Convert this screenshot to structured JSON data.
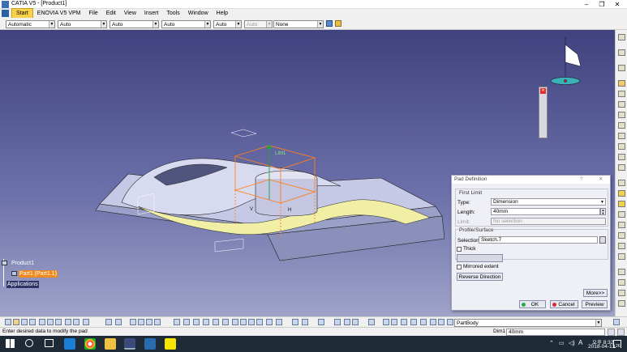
{
  "window": {
    "title": "CATIA V5 - [Product1]",
    "min": "–",
    "max": "❐",
    "close": "✕"
  },
  "menu": [
    "Start",
    "ENOVIA V5 VPM",
    "File",
    "Edit",
    "View",
    "Insert",
    "Tools",
    "Window",
    "Help"
  ],
  "combos": [
    {
      "value": "Automatic",
      "disabled": false
    },
    {
      "value": "Auto",
      "disabled": false
    },
    {
      "value": "Auto",
      "disabled": false
    },
    {
      "value": "Auto",
      "disabled": false
    },
    {
      "value": "Auto",
      "disabled": false
    },
    {
      "value": "Auto",
      "disabled": true
    },
    {
      "value": "None",
      "disabled": false
    }
  ],
  "tree": {
    "root": "Product1",
    "part": "Part1 (Part1.1)",
    "apps": "Applications"
  },
  "annotations": {
    "lim1": "LIM1",
    "h": "H",
    "v": "V"
  },
  "dialog": {
    "title": "Pad Definition",
    "help": "?",
    "close": "✕",
    "first_limit": "First Limit",
    "type_label": "Type:",
    "type_value": "Dimension",
    "length_label": "Length:",
    "length_value": "40mm",
    "limit_label": "Limit:",
    "limit_value": "No selection",
    "profile_label": "Profile/Surface",
    "selection_label": "Selection:",
    "selection_value": "Sketch.7",
    "thick_label": "Thick",
    "mirrored_label": "Mirrored extent",
    "reverse_label": "Reverse Direction",
    "more_label": "More>>",
    "ok_label": "OK",
    "cancel_label": "Cancel",
    "preview_label": "Preview"
  },
  "bottom": {
    "partbody": "PartBody"
  },
  "status": {
    "message": "Enter desired data to modify the pad",
    "dim_label": "Dim1",
    "dim_value": "40mm"
  },
  "taskbar": {
    "time": "오후 8:32",
    "date": "2018-04-13",
    "ime": "A",
    "notif": "26"
  }
}
